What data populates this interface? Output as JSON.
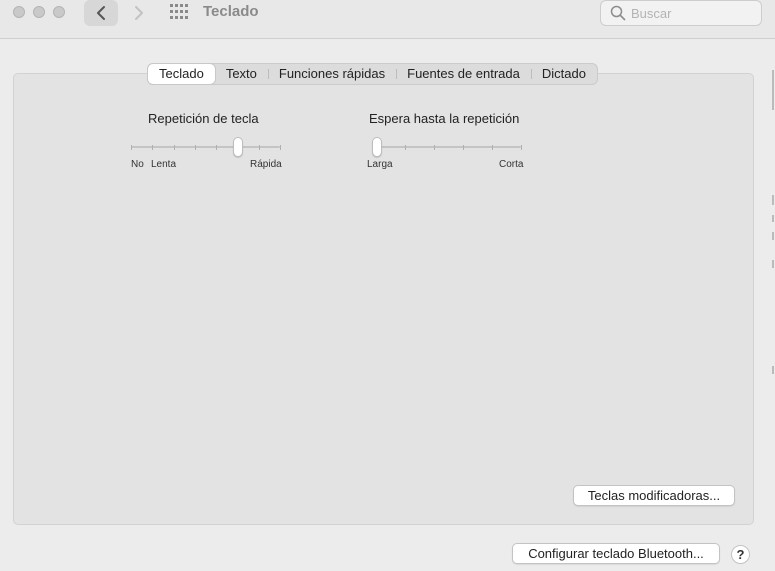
{
  "window": {
    "title": "Teclado",
    "search_placeholder": "Buscar"
  },
  "tabs": [
    {
      "label": "Teclado",
      "selected": true
    },
    {
      "label": "Texto",
      "selected": false
    },
    {
      "label": "Funciones rápidas",
      "selected": false
    },
    {
      "label": "Fuentes de entrada",
      "selected": false
    },
    {
      "label": "Dictado",
      "selected": false
    }
  ],
  "key_repeat": {
    "title": "Repetición de tecla",
    "label_off": "No",
    "label_min": "Lenta",
    "label_max": "Rápida",
    "tick_count": 8,
    "value_index": 5
  },
  "delay_until_repeat": {
    "title": "Espera hasta la repetición",
    "label_min": "Larga",
    "label_max": "Corta",
    "tick_count": 6,
    "value_index": 0
  },
  "buttons": {
    "modifier_keys": "Teclas modificadoras...",
    "bluetooth": "Configurar teclado Bluetooth...",
    "help": "?"
  },
  "icons": [
    "close-light-icon",
    "minimize-light-icon",
    "zoom-light-icon",
    "back-chevron-icon",
    "forward-chevron-icon",
    "grid-icon",
    "search-icon"
  ],
  "colors": {
    "window_bg": "#ececec",
    "panel_bg": "#e3e3e3",
    "selected_tab_bg": "#ffffff"
  }
}
